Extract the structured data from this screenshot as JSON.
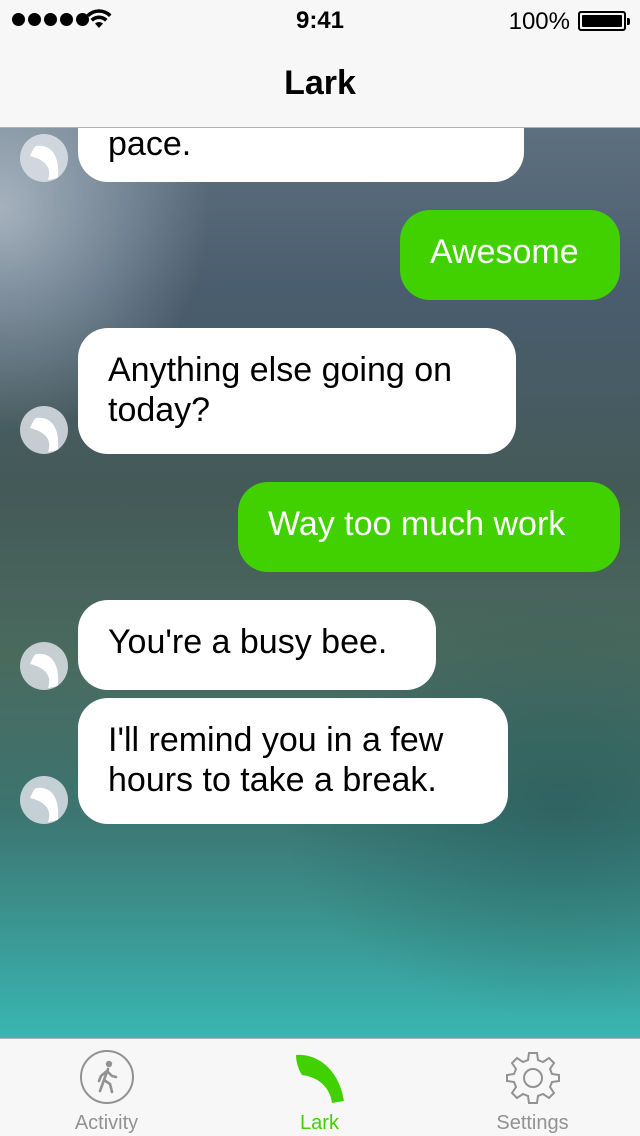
{
  "status_bar": {
    "time": "9:41",
    "battery_percent": "100%",
    "signal_bars": 5
  },
  "nav": {
    "title": "Lark"
  },
  "messages": [
    {
      "from": "lark",
      "text": "pace."
    },
    {
      "from": "user",
      "text": "Awesome"
    },
    {
      "from": "lark",
      "text": "Anything else going on today?"
    },
    {
      "from": "user",
      "text": "Way too much work"
    },
    {
      "from": "lark",
      "text": "You're a busy bee."
    },
    {
      "from": "lark",
      "text": "I'll remind you in a few hours to take a break."
    }
  ],
  "tabs": [
    {
      "label": "Activity",
      "icon": "walking-person-icon",
      "active": false
    },
    {
      "label": "Lark",
      "icon": "lark-leaf-icon",
      "active": true
    },
    {
      "label": "Settings",
      "icon": "gear-icon",
      "active": false
    }
  ],
  "colors": {
    "accent": "#42d100",
    "outgoing_bubble": "#42d100",
    "incoming_bubble": "#ffffff",
    "tab_inactive": "#929292"
  }
}
